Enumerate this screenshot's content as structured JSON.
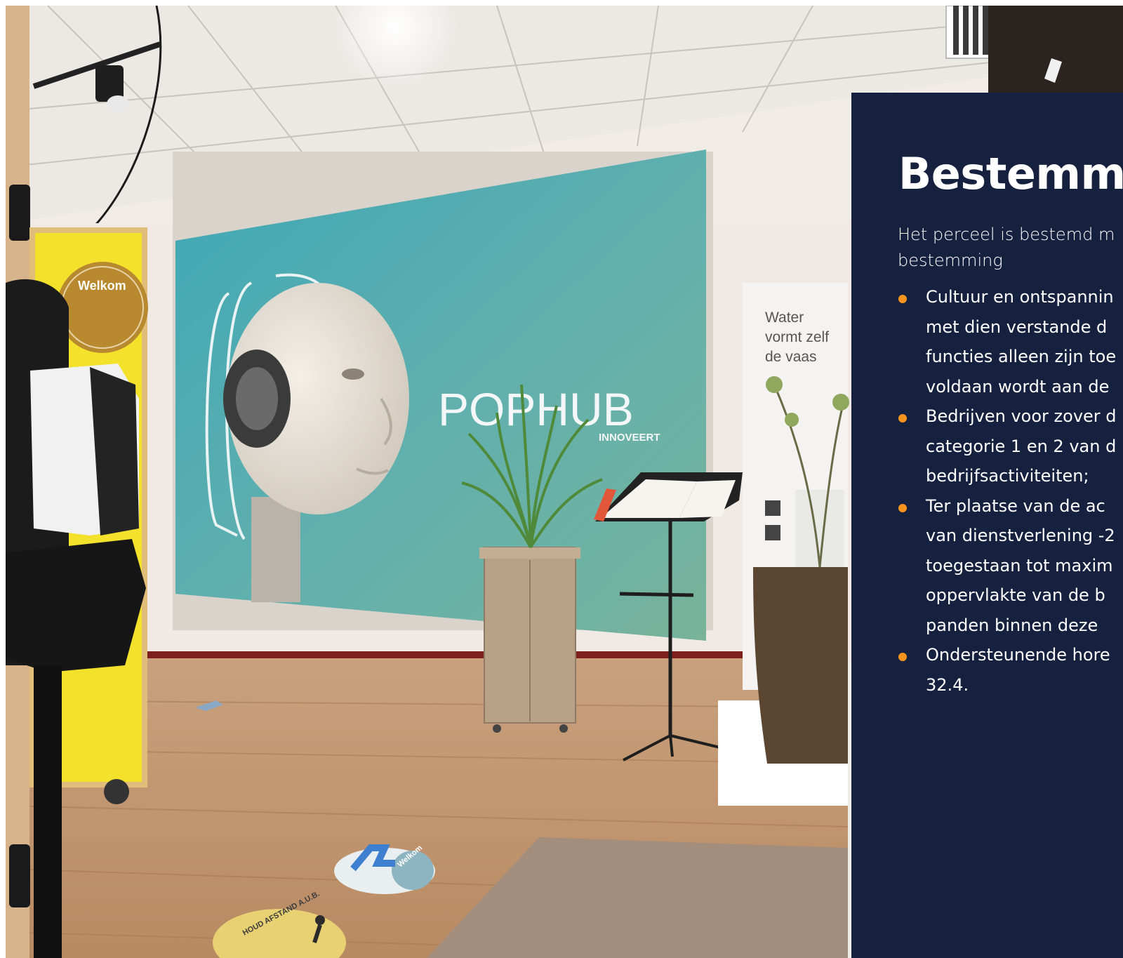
{
  "photo": {
    "signs": {
      "welkom": "Welkom",
      "water_line_1": "Water",
      "water_line_2": "vormt zelf",
      "water_line_3": "de vaas",
      "brand": "POPHUB",
      "tagline": "INNOVEERT",
      "floor_sticker_welkom": "Welkom",
      "floor_sticker_afstand": "HOUD AFSTAND A.U.B."
    }
  },
  "panel": {
    "title": "Bestemmi",
    "intro_lines": [
      "Het perceel is bestemd m",
      "bestemming"
    ],
    "items": [
      {
        "lines": [
          "Cultuur en ontspannin",
          "met dien verstande d",
          "functies alleen zijn toe",
          "voldaan wordt aan de"
        ]
      },
      {
        "lines": [
          "Bedrijven voor zover d",
          "categorie 1 en 2 van d",
          "bedrijfsactiviteiten;"
        ]
      },
      {
        "lines": [
          "Ter plaatse van de ac",
          "van dienstverlening -2",
          "toegestaan tot maxim",
          "oppervlakte van de b",
          "panden binnen deze"
        ]
      },
      {
        "lines": [
          "Ondersteunende hore",
          "32.4."
        ]
      }
    ]
  }
}
